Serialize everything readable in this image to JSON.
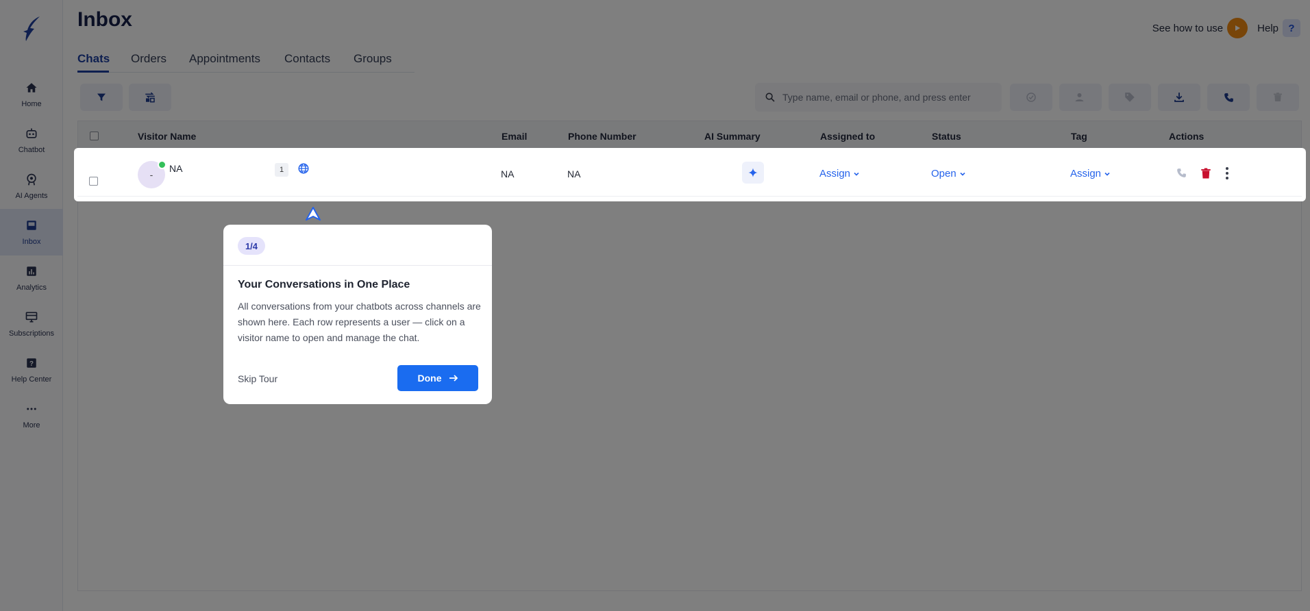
{
  "app": {
    "page_title": "Inbox",
    "help": {
      "see_how_label": "See how to use",
      "help_label": "Help",
      "help_badge": "?"
    }
  },
  "sidebar": {
    "items": [
      {
        "label": "Home",
        "icon": "home-icon"
      },
      {
        "label": "Chatbot",
        "icon": "robot-icon"
      },
      {
        "label": "AI Agents",
        "icon": "ai-agent-icon"
      },
      {
        "label": "Inbox",
        "icon": "inbox-icon",
        "active": true
      },
      {
        "label": "Analytics",
        "icon": "analytics-icon"
      },
      {
        "label": "Subscriptions",
        "icon": "subscriptions-icon"
      },
      {
        "label": "Help Center",
        "icon": "help-center-icon"
      },
      {
        "label": "More",
        "icon": "more-icon"
      }
    ]
  },
  "tabs": [
    {
      "label": "Chats",
      "active": true
    },
    {
      "label": "Orders"
    },
    {
      "label": "Appointments"
    },
    {
      "label": "Contacts"
    },
    {
      "label": "Groups"
    }
  ],
  "search": {
    "placeholder": "Type name, email or phone, and press enter"
  },
  "table": {
    "columns": [
      "Visitor Name",
      "Email",
      "Phone Number",
      "AI Summary",
      "Assigned to",
      "Status",
      "Tag",
      "Actions"
    ],
    "rows": [
      {
        "avatar": "-",
        "visitor_name": "NA",
        "message_count": "1",
        "email": "NA",
        "phone": "NA",
        "assigned_to": "Assign",
        "status": "Open",
        "tag": "Assign"
      }
    ]
  },
  "tour": {
    "step": "1/4",
    "title": "Your Conversations in One Place",
    "body": "All conversations from your chatbots across channels are shown here. Each row represents a user — click on a visitor name to open and manage the chat.",
    "skip_label": "Skip Tour",
    "done_label": "Done"
  },
  "colors": {
    "accent": "#1c3fa0",
    "link": "#2563eb",
    "primary_button": "#1a6cf0",
    "online": "#34c05a",
    "delete": "#c8102e",
    "play": "#f18a12"
  }
}
